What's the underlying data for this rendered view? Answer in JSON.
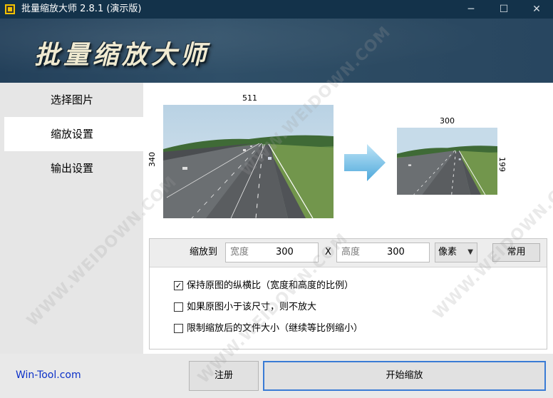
{
  "window": {
    "title": "批量缩放大师 2.8.1 (演示版)",
    "controls": {
      "minimize": "─",
      "maximize": "☐",
      "close": "✕"
    }
  },
  "banner": {
    "title": "批量缩放大师"
  },
  "sidebar": {
    "items": [
      {
        "label": "选择图片",
        "active": false
      },
      {
        "label": "缩放设置",
        "active": true
      },
      {
        "label": "输出设置",
        "active": false
      }
    ]
  },
  "preview": {
    "source": {
      "width": "511",
      "height": "340"
    },
    "target": {
      "width": "300",
      "height": "199"
    },
    "arrow_icon": "right-arrow-icon"
  },
  "resize": {
    "label": "缩放到",
    "width_placeholder": "宽度",
    "width_value": "300",
    "separator": "X",
    "height_placeholder": "高度",
    "height_value": "300",
    "unit": "像素",
    "preset_button": "常用"
  },
  "options": [
    {
      "label": "保持原图的纵横比（宽度和高度的比例）",
      "checked": true
    },
    {
      "label": "如果原图小于该尺寸，则不放大",
      "checked": false
    },
    {
      "label": "限制缩放后的文件大小（继续等比例缩小）",
      "checked": false
    }
  ],
  "footer": {
    "link": "Win-Tool.com",
    "register_button": "注册",
    "start_button": "开始缩放"
  },
  "watermark": "WWW.WEIDOWN.COM",
  "colors": {
    "titlebar": "#13324a",
    "link": "#0b30c8",
    "accent_border": "#3a7bd5"
  }
}
